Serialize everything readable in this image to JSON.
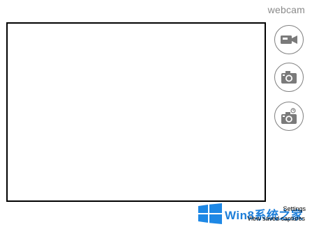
{
  "app": {
    "title": "webcam"
  },
  "controls": {
    "video_icon": "video-camera-icon",
    "photo_icon": "camera-icon",
    "timer_icon": "camera-timer-icon"
  },
  "footer": {
    "settings_label": "Settings",
    "view_captures_label": "View saved captures"
  },
  "watermark": {
    "text": "Win8系统之家",
    "logo": "windows-logo",
    "color": "#1e7fd9"
  },
  "colors": {
    "preview_border": "#000000",
    "button_border": "#7f7f7f",
    "title": "#8a8a8a"
  }
}
